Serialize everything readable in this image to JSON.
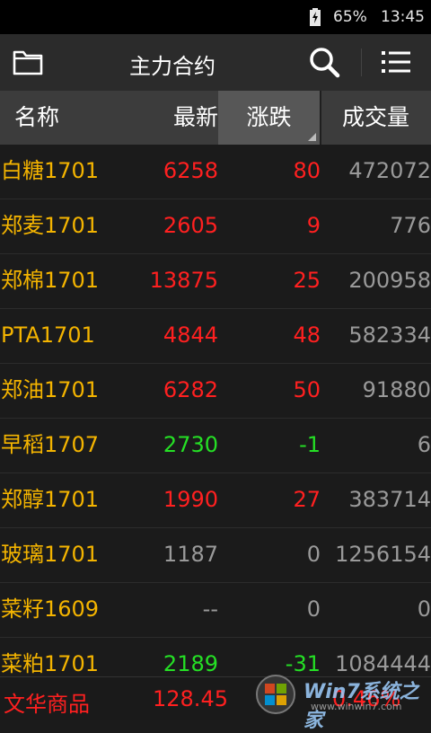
{
  "status_bar": {
    "battery": "65%",
    "time": "13:45"
  },
  "toolbar": {
    "title": "主力合约",
    "icons": [
      "folder-icon",
      "search-icon",
      "menu-icon"
    ]
  },
  "header": {
    "name": "名称",
    "latest": "最新",
    "change": "涨跌",
    "volume": "成交量"
  },
  "rows": [
    {
      "name": "白糖1701",
      "latest": "6258",
      "change": "80",
      "volume": "472072",
      "trend": "up"
    },
    {
      "name": "郑麦1701",
      "latest": "2605",
      "change": "9",
      "volume": "776",
      "trend": "up"
    },
    {
      "name": "郑棉1701",
      "latest": "13875",
      "change": "25",
      "volume": "200958",
      "trend": "up"
    },
    {
      "name": "PTA1701",
      "latest": "4844",
      "change": "48",
      "volume": "582334",
      "trend": "up"
    },
    {
      "name": "郑油1701",
      "latest": "6282",
      "change": "50",
      "volume": "91880",
      "trend": "up"
    },
    {
      "name": "早稻1707",
      "latest": "2730",
      "change": "-1",
      "volume": "6",
      "trend": "down"
    },
    {
      "name": "郑醇1701",
      "latest": "1990",
      "change": "27",
      "volume": "383714",
      "trend": "up"
    },
    {
      "name": "玻璃1701",
      "latest": "1187",
      "change": "0",
      "volume": "1256154",
      "trend": "flat"
    },
    {
      "name": "菜籽1609",
      "latest": "--",
      "change": "0",
      "volume": "0",
      "trend": "flat"
    },
    {
      "name": "菜粕1701",
      "latest": "2189",
      "change": "-31",
      "volume": "1084444",
      "trend": "down"
    }
  ],
  "index_bar": {
    "name": "文华商品",
    "value": "128.45",
    "percent": "0.46%"
  },
  "watermark": {
    "text": "Win7系统之家",
    "sub": "www.winwin7.com"
  },
  "colors": {
    "up": "#ff2020",
    "down": "#25e025",
    "flat": "#9a9a9a",
    "name": "#f4b400"
  }
}
